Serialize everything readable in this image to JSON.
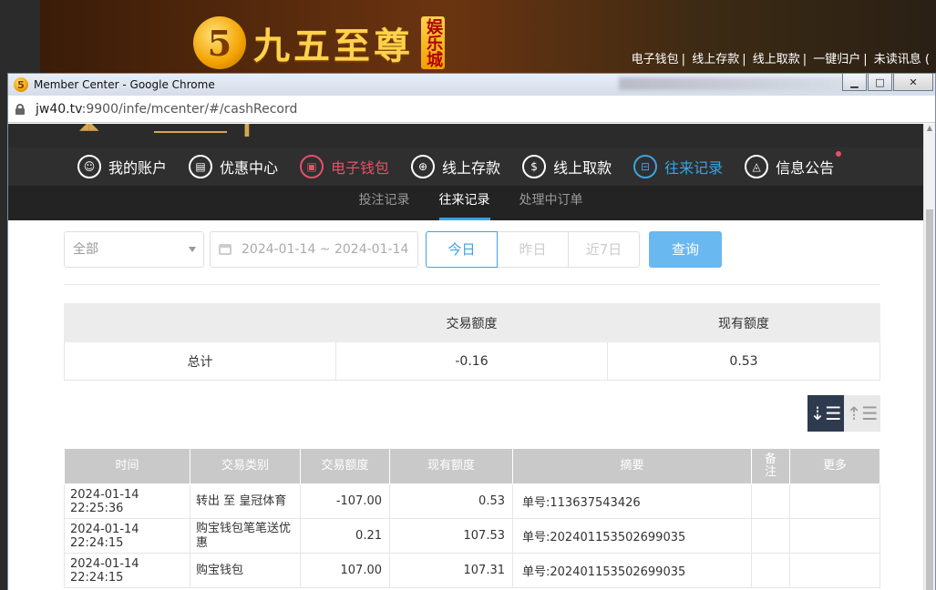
{
  "site": {
    "logo_glyph": "5",
    "logo_text": "九五至尊",
    "logo_tag": "娱乐城",
    "top_links": [
      "电子钱包",
      "线上存款",
      "线上取款",
      "一键归户",
      "未读讯息 ("
    ]
  },
  "window": {
    "title": "Member Center - Google Chrome",
    "url_host": "jw40.tv",
    "url_path": ":9900/infe/mcenter/#/cashRecord",
    "btn_min": "▁",
    "btn_max": "□",
    "btn_close": "✕"
  },
  "nav": {
    "items": [
      {
        "label": "我的账户",
        "icon": "user-icon",
        "glyph": "☺"
      },
      {
        "label": "优惠中心",
        "icon": "gift-icon",
        "glyph": "▤"
      },
      {
        "label": "电子钱包",
        "icon": "wallet-icon",
        "glyph": "▣"
      },
      {
        "label": "线上存款",
        "icon": "deposit-icon",
        "glyph": "⊕"
      },
      {
        "label": "线上取款",
        "icon": "withdraw-icon",
        "glyph": "$"
      },
      {
        "label": "往来记录",
        "icon": "records-icon",
        "glyph": "⊟"
      },
      {
        "label": "信息公告",
        "icon": "bell-icon",
        "glyph": "◬"
      }
    ],
    "colors": {
      "active_red": "#e5506a",
      "active_blue": "#3aa3e3"
    }
  },
  "subnav": {
    "items": [
      "投注记录",
      "往来记录",
      "处理中订单"
    ],
    "active": "往来记录"
  },
  "filters": {
    "type_value": "全部",
    "date_range": "2024-01-14 ~ 2024-01-14",
    "periods": [
      "今日",
      "昨日",
      "近7日"
    ],
    "active_period": "今日",
    "query_label": "查询"
  },
  "summary": {
    "headers": [
      "",
      "交易额度",
      "现有额度"
    ],
    "row": {
      "label": "总计",
      "amount": "-0.16",
      "balance": "0.53"
    }
  },
  "sort": {
    "desc_icon": "sort-desc-icon",
    "asc_icon": "sort-asc-icon"
  },
  "records": {
    "headers": [
      "时间",
      "交易类别",
      "交易额度",
      "现有额度",
      "摘要",
      "备注",
      "更多"
    ],
    "rows": [
      {
        "time": "2024-01-14 22:25:36",
        "type": "转出 至 皇冠体育",
        "amount": "-107.00",
        "balance": "0.53",
        "memo": "单号:113637543426",
        "note": "",
        "more": ""
      },
      {
        "time": "2024-01-14 22:24:15",
        "type": "购宝钱包笔笔送优惠",
        "amount": "0.21",
        "balance": "107.53",
        "memo": "单号:202401153502699035",
        "note": "",
        "more": ""
      },
      {
        "time": "2024-01-14 22:24:15",
        "type": "购宝钱包",
        "amount": "107.00",
        "balance": "107.31",
        "memo": "单号:202401153502699035",
        "note": "",
        "more": ""
      }
    ]
  }
}
